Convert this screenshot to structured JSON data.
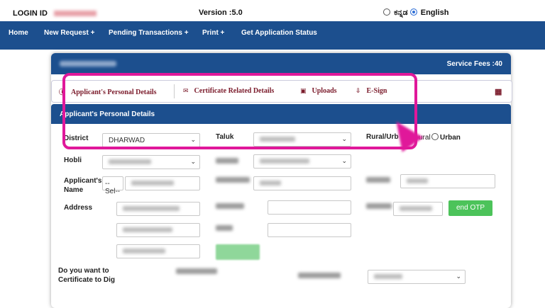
{
  "topbar": {
    "login_label": "LOGIN ID",
    "version": "Version :5.0",
    "lang_kannada": "ಕನ್ನಡ",
    "lang_english": "English"
  },
  "nav": {
    "items": [
      {
        "label": "Home"
      },
      {
        "label": "New Request  +"
      },
      {
        "label": "Pending Transactions  +"
      },
      {
        "label": "Print  +"
      },
      {
        "label": "Get Application Status"
      }
    ]
  },
  "card": {
    "service_fees": "Service Fees :40"
  },
  "tabs": {
    "applicant": "Applicant's   Personal   Details",
    "certificate": "Certificate   Related   Details",
    "uploads": "Uploads",
    "esign": "E-Sign"
  },
  "section": {
    "title": "Applicant's Personal Details"
  },
  "form": {
    "district_label": "District",
    "district_value": "DHARWAD",
    "taluk_label": "Taluk",
    "rural_label": "Rural/Urb",
    "rural_option": "ural",
    "urban_option": "Urban",
    "hobli_label": "Hobli",
    "applicant_name_label": "Applicant's Name",
    "applicant_prefix": "--Sel--",
    "address_label": "Address",
    "send_otp": "end OTP",
    "question_line1": "Do you want to",
    "question_line2": "Certificate to Dig"
  },
  "colors": {
    "navbar": "#1c4f8e",
    "highlight": "#e0189a",
    "otp_button": "#4cc35a"
  }
}
